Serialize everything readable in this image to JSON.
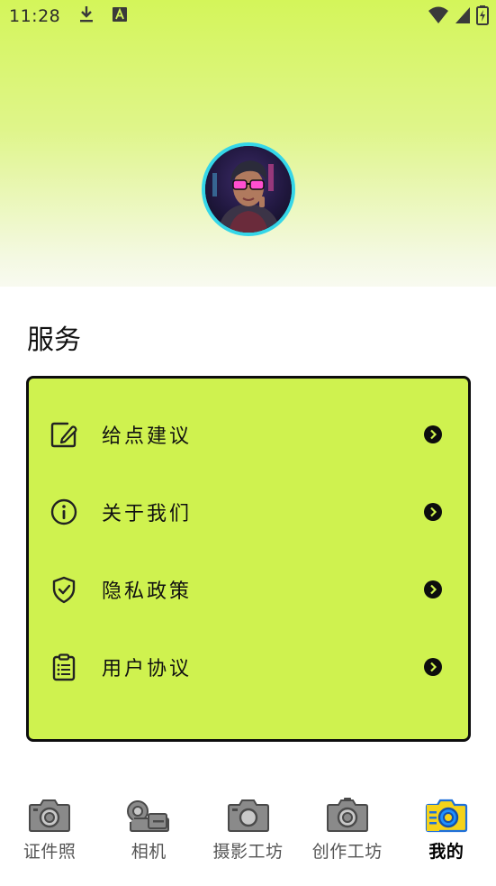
{
  "status_bar": {
    "time": "11:28",
    "icons": [
      "download-icon",
      "a-badge-icon",
      "wifi-icon",
      "signal-icon",
      "battery-charging-icon"
    ]
  },
  "profile": {
    "avatar": "avatar"
  },
  "services": {
    "title": "服务",
    "items": [
      {
        "label": "给点建议",
        "icon": "edit-icon"
      },
      {
        "label": "关于我们",
        "icon": "info-icon"
      },
      {
        "label": "隐私政策",
        "icon": "shield-check-icon"
      },
      {
        "label": "用户协议",
        "icon": "clipboard-list-icon"
      }
    ]
  },
  "tabbar": {
    "tabs": [
      {
        "label": "证件照",
        "icon": "camera-icon",
        "active": false
      },
      {
        "label": "相机",
        "icon": "video-camera-icon",
        "active": false
      },
      {
        "label": "摄影工坊",
        "icon": "camera-icon",
        "active": false
      },
      {
        "label": "创作工坊",
        "icon": "camera-icon",
        "active": false
      },
      {
        "label": "我的",
        "icon": "camera-active-icon",
        "active": true
      }
    ]
  },
  "colors": {
    "accent": "#cff24f",
    "avatar_ring": "#35d6e8",
    "active_tab_blue": "#1e90ff",
    "active_tab_yellow": "#f5d21a"
  }
}
